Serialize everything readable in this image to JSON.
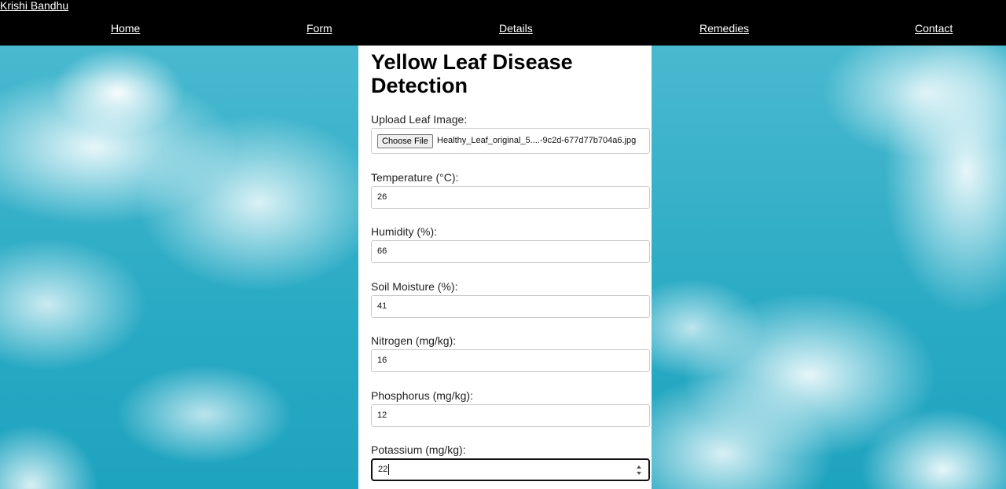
{
  "nav": {
    "brand": "Krishi Bandhu",
    "items": [
      {
        "label": "Home"
      },
      {
        "label": "Form"
      },
      {
        "label": "Details"
      },
      {
        "label": "Remedies"
      },
      {
        "label": "Contact"
      }
    ]
  },
  "form": {
    "title": "Yellow Leaf Disease Detection",
    "upload": {
      "label": "Upload Leaf Image:",
      "button": "Choose File",
      "filename": "Healthy_Leaf_original_5....-9c2d-677d77b704a6.jpg"
    },
    "fields": [
      {
        "label": "Temperature (°C):",
        "value": "26"
      },
      {
        "label": "Humidity (%):",
        "value": "66"
      },
      {
        "label": "Soil Moisture (%):",
        "value": "41"
      },
      {
        "label": "Nitrogen (mg/kg):",
        "value": "16"
      },
      {
        "label": "Phosphorus (mg/kg):",
        "value": "12"
      },
      {
        "label": "Potassium (mg/kg):",
        "value": "22"
      }
    ]
  },
  "icons": {
    "spinner": "number-stepper-icon"
  },
  "colors": {
    "navbar": "#000000",
    "panel": "#ffffff",
    "sky": "#2aaac4"
  }
}
